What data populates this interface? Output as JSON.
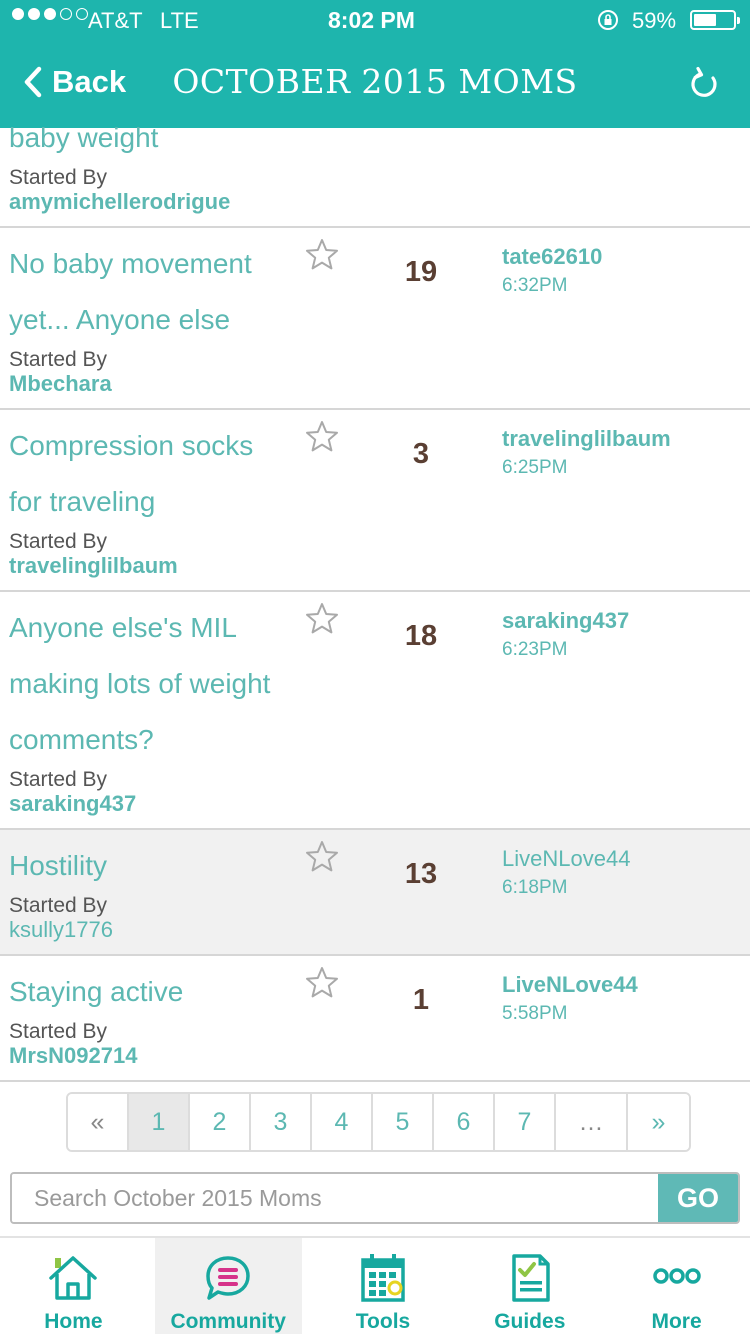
{
  "status_bar": {
    "carrier": "AT&T",
    "network": "LTE",
    "time": "8:02 PM",
    "battery_pct": "59%",
    "battery_level": 0.59,
    "signal_bars": 3
  },
  "nav": {
    "back_label": "Back",
    "title": "OCTOBER 2015 MOMS",
    "refresh_icon": "refresh-icon"
  },
  "threads": [
    {
      "title": "baby weight",
      "started_by_label": "Started By",
      "starter": "amymichellerodrigue"
    },
    {
      "title_lines": [
        "No baby movement",
        "yet... Anyone else"
      ],
      "started_by_label": "Started By",
      "starter": "Mbechara",
      "replies": "19",
      "last_user": "tate62610",
      "last_time": "6:32PM"
    },
    {
      "title_lines": [
        "Compression socks",
        "for traveling"
      ],
      "started_by_label": "Started By",
      "starter": "travelinglilbaum",
      "replies": "3",
      "last_user": "travelinglilbaum",
      "last_time": "6:25PM"
    },
    {
      "title_lines": [
        "Anyone else's MIL",
        "making lots of weight",
        "comments?"
      ],
      "started_by_label": "Started By",
      "starter": "saraking437",
      "replies": "18",
      "last_user": "saraking437",
      "last_time": "6:23PM"
    },
    {
      "title_lines": [
        "Hostility"
      ],
      "started_by_label": "Started By",
      "starter": "ksully1776",
      "replies": "13",
      "last_user": "LiveNLove44",
      "last_time": "6:18PM"
    },
    {
      "title_lines": [
        "Staying active"
      ],
      "started_by_label": "Started By",
      "starter": "MrsN092714",
      "replies": "1",
      "last_user": "LiveNLove44",
      "last_time": "5:58PM"
    }
  ],
  "pagination": {
    "prev": "«",
    "pages": [
      "1",
      "2",
      "3",
      "4",
      "5",
      "6",
      "7"
    ],
    "ellipsis": "…",
    "next": "»",
    "current": "1"
  },
  "search": {
    "placeholder": "Search October 2015 Moms",
    "go_label": "GO"
  },
  "tabs": [
    {
      "label": "Home",
      "icon": "home-icon"
    },
    {
      "label": "Community",
      "icon": "community-chat-icon"
    },
    {
      "label": "Tools",
      "icon": "calendar-icon"
    },
    {
      "label": "Guides",
      "icon": "guide-document-icon"
    },
    {
      "label": "More",
      "icon": "more-dots-icon"
    }
  ],
  "colors": {
    "brand_teal": "#1eb5ad",
    "link_teal": "#5cb8b2",
    "count_brown": "#5a3f33",
    "accent_pink": "#d6338a",
    "accent_yellow": "#e7d421"
  }
}
